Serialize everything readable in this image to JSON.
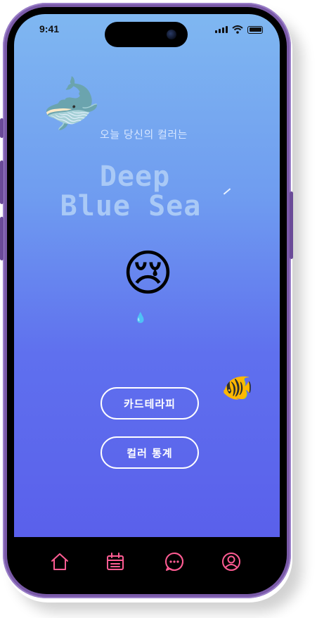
{
  "status_bar": {
    "time": "9:41"
  },
  "hero": {
    "subtitle": "오늘 당신의 컬러는",
    "title_line1": "Deep",
    "title_line2": "Blue Sea"
  },
  "decor": {
    "whale_emoji": "🐋",
    "cry_emoji": "😢",
    "drop_emoji": "💧",
    "fish_emoji": "🐠"
  },
  "buttons": {
    "card_therapy": "카드테라피",
    "color_stats": "컬러 통계"
  },
  "tabbar": {
    "items": [
      {
        "icon": "home-icon"
      },
      {
        "icon": "calendar-icon"
      },
      {
        "icon": "chat-icon"
      },
      {
        "icon": "profile-icon"
      }
    ],
    "icon_color": "#ff5c93"
  },
  "colors": {
    "gradient_top": "#7fb7f1",
    "gradient_bottom": "#5a60eb",
    "frame": "#7a5aa8",
    "title_color": "#a9c9f6"
  }
}
